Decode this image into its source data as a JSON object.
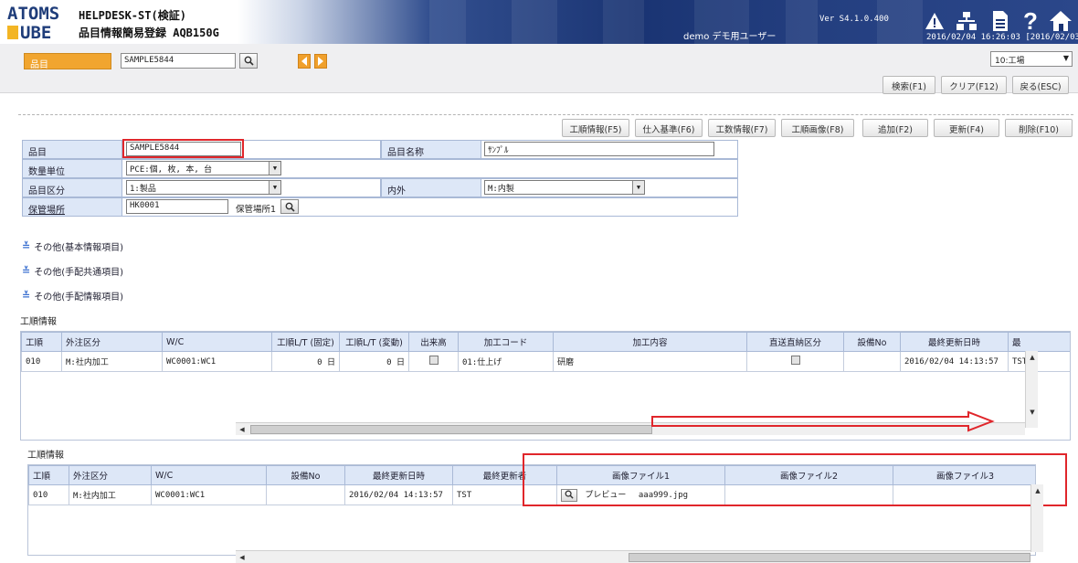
{
  "header": {
    "logo_line1": "ATOMS",
    "logo_line2": "UBE",
    "app_name": "HELPDESK-ST(検証)",
    "screen_name": "品目情報簡易登録 AQB150G",
    "user": "demo デモ用ユーザー",
    "version": "Ver S4.1.0.400",
    "datetime": "2016/02/04 16:26:03 [2016/02/03]",
    "icons": [
      "warning-icon",
      "org-chart-icon",
      "document-icon",
      "help-icon",
      "home-icon"
    ]
  },
  "search": {
    "label": "品目",
    "value": "SAMPLE5844",
    "plant": "10:工場",
    "buttons": [
      "検索(F1)",
      "クリア(F12)",
      "戻る(ESC)"
    ]
  },
  "toolbar": {
    "buttons": [
      "工順情報(F5)",
      "仕入基準(F6)",
      "工数情報(F7)",
      "工順画像(F8)",
      "追加(F2)",
      "更新(F4)",
      "削除(F10)"
    ]
  },
  "form": {
    "item_label": "品目",
    "item_value": "SAMPLE5844",
    "item_name_label": "品目名称",
    "item_name_value": "ｻﾝﾌﾟﾙ",
    "unit_label": "数量単位",
    "unit_value": "PCE:個, 枚, 本, 台",
    "class_label": "品目区分",
    "class_value": "1:製品",
    "inout_label": "内外",
    "inout_value": "M:内製",
    "location_label": "保管場所",
    "location_value": "HK0001",
    "location_name": "保管場所1"
  },
  "sections": [
    "その他(基本情報項目)",
    "その他(手配共通項目)",
    "その他(手配情報項目)"
  ],
  "grid1": {
    "title": "工順情報",
    "columns": [
      "工順",
      "外注区分",
      "W/C",
      "工順L/T (固定)",
      "工順L/T (変動)",
      "出来高",
      "加工コード",
      "加工内容",
      "直送直納区分",
      "設備No",
      "最終更新日時",
      "最"
    ],
    "row": {
      "seq": "010",
      "outsource": "M:社内加工",
      "wc": "WC0001:WC1",
      "lt_fixed": "0 日",
      "lt_var": "0 日",
      "proc_code": "01:仕上げ",
      "proc_desc": "研磨",
      "updated_at": "2016/02/04 14:13:57",
      "updated_by": "TST"
    }
  },
  "grid2": {
    "title": "工順情報",
    "columns": [
      "工順",
      "外注区分",
      "W/C",
      "設備No",
      "最終更新日時",
      "最終更新者",
      "画像ファイル1",
      "画像ファイル2",
      "画像ファイル3"
    ],
    "row": {
      "seq": "010",
      "outsource": "M:社内加工",
      "wc": "WC0001:WC1",
      "updated_at": "2016/02/04 14:13:57",
      "updated_by": "TST",
      "preview_label": "プレビュー",
      "image_file": "aaa999.jpg"
    }
  },
  "colors": {
    "accent_orange": "#f1a52f",
    "highlight_red": "#e0262b",
    "label_blue": "#dde7f7",
    "banner_navy": "#1a3473"
  }
}
